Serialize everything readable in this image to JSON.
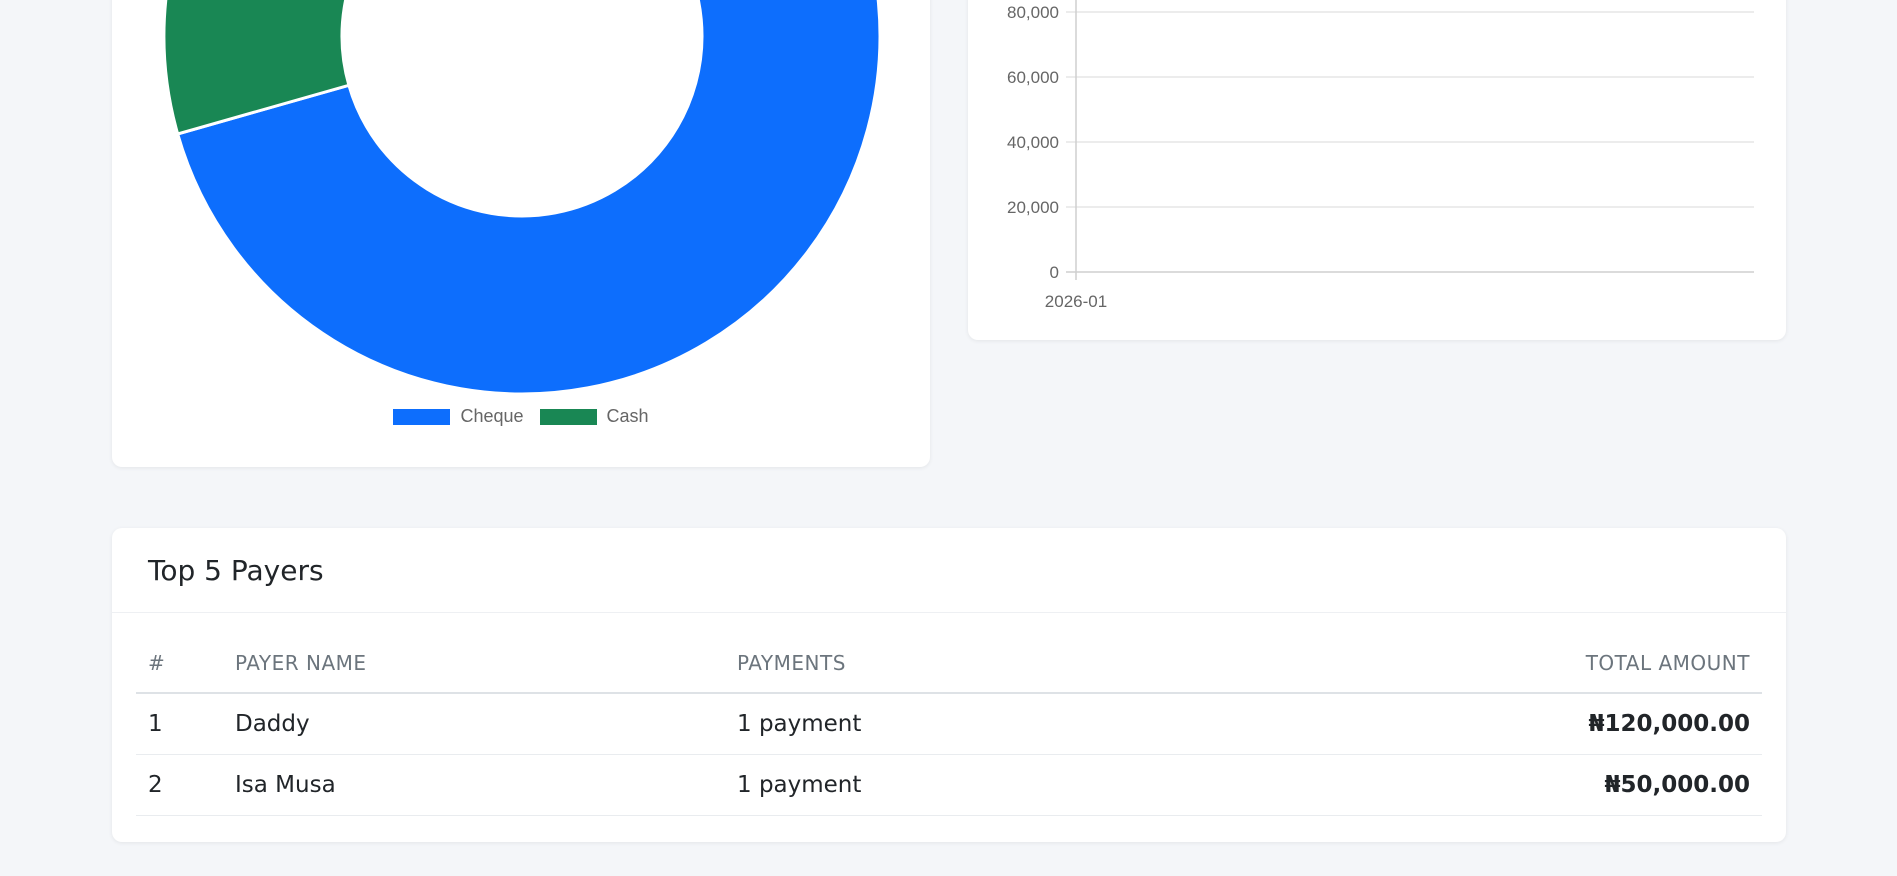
{
  "colors": {
    "cheque": "#0d6efd",
    "cash": "#198754",
    "page_bg": "#f4f6f9"
  },
  "payment_method_chart": {
    "chart_data": {
      "type": "pie",
      "variant": "doughnut",
      "categories": [
        "Cheque",
        "Cash"
      ],
      "values": [
        120000,
        50000
      ],
      "colors": [
        "#0d6efd",
        "#198754"
      ],
      "legend_position": "bottom"
    },
    "legend": [
      {
        "label": "Cheque",
        "color": "#0d6efd"
      },
      {
        "label": "Cash",
        "color": "#198754"
      }
    ]
  },
  "monthly_chart": {
    "chart_data": {
      "type": "line",
      "x": [
        "2026-01"
      ],
      "y_ticks": [
        "0",
        "20,000",
        "40,000",
        "60,000",
        "80,000"
      ],
      "y_tick_values": [
        0,
        20000,
        40000,
        60000,
        80000
      ],
      "x_tick_labels": [
        "2026-01"
      ],
      "grid": true
    }
  },
  "top_payers": {
    "title": "Top 5 Payers",
    "headers": {
      "num": "#",
      "name": "PAYER NAME",
      "payments": "PAYMENTS",
      "amount": "TOTAL AMOUNT"
    },
    "rows": [
      {
        "num": "1",
        "name": "Daddy",
        "payments": "1 payment",
        "amount": "₦120,000.00"
      },
      {
        "num": "2",
        "name": "Isa Musa",
        "payments": "1 payment",
        "amount": "₦50,000.00"
      }
    ]
  }
}
